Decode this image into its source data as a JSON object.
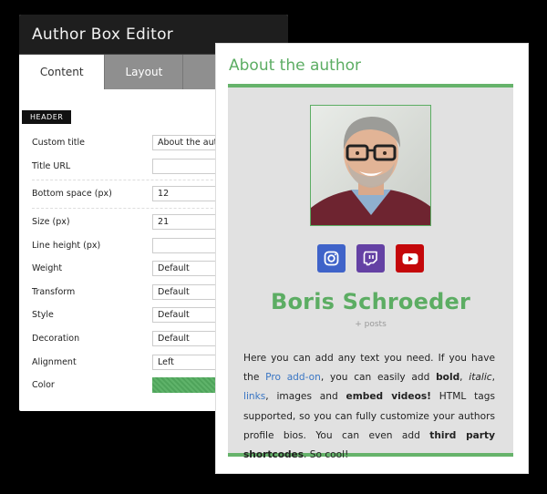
{
  "editor": {
    "title": "Author Box Editor",
    "tabs": [
      {
        "label": "Content"
      },
      {
        "label": "Layout"
      },
      {
        "label": ""
      }
    ],
    "section_header": "HEADER",
    "fields": {
      "custom_title": {
        "label": "Custom title",
        "value": "About the author"
      },
      "title_url": {
        "label": "Title URL",
        "value": ""
      },
      "bottom_space": {
        "label": "Bottom space (px)",
        "value": "12"
      },
      "size": {
        "label": "Size (px)",
        "value": "21"
      },
      "line_height": {
        "label": "Line height (px)",
        "value": ""
      },
      "weight": {
        "label": "Weight",
        "value": "Default"
      },
      "transform": {
        "label": "Transform",
        "value": "Default"
      },
      "style": {
        "label": "Style",
        "value": "Default"
      },
      "decoration": {
        "label": "Decoration",
        "value": "Default"
      },
      "alignment": {
        "label": "Alignment",
        "value": "Left"
      },
      "color": {
        "label": "Color",
        "value": "#5fb36a"
      }
    }
  },
  "preview": {
    "title": "About the author",
    "author_name": "Boris Schroeder",
    "posts_link": "+ posts",
    "socials": [
      {
        "icon": "instagram-icon",
        "color": "#3f63c9"
      },
      {
        "icon": "twitch-icon",
        "color": "#6441a4"
      },
      {
        "icon": "youtube-icon",
        "color": "#c4070a"
      }
    ],
    "bio": {
      "p1": "Here you can add any text you need. If you have the ",
      "pro_link": "Pro add-on",
      "p2": ", you can easily add ",
      "bold": "bold",
      "p3": ", ",
      "italic": "italic",
      "p4": ", ",
      "links": "links",
      "p5": ", images and ",
      "embed": "embed videos!",
      "p6": " HTML tags supported, so you can fully customize your authors profile bios. You can even add ",
      "shortcodes": "third party shortcodes",
      "p7": ". So cool!"
    },
    "accent_color": "#5cad63"
  }
}
